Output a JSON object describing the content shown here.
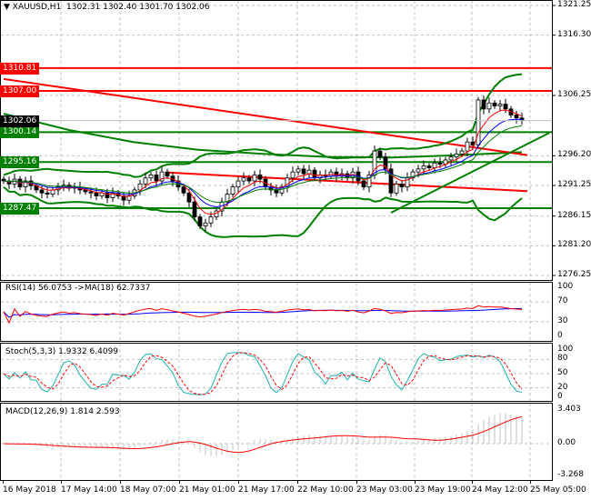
{
  "header": {
    "symbol_label": "XAUUSD,H1",
    "ohlc": "1302.31 1302.40 1301.70 1302.06"
  },
  "chart_data": {
    "type": "candlestick",
    "symbol": "XAUUSD",
    "timeframe": "H1",
    "price_ticks": [
      "1321.25",
      "1316.30",
      "1306.25",
      "1296.20",
      "1291.25",
      "1286.15",
      "1281.20",
      "1276.25"
    ],
    "ylim": [
      1276.25,
      1321.25
    ],
    "time_ticks": [
      "16 May 2018",
      "17 May 14:00",
      "18 May 07:00",
      "21 May 01:00",
      "21 May 17:00",
      "22 May 10:00",
      "23 May 03:00",
      "23 May 19:00",
      "24 May 12:00",
      "25 May 05:00"
    ],
    "closes": [
      1292,
      1291.5,
      1292.3,
      1291,
      1292,
      1291.2,
      1290.5,
      1290,
      1289.8,
      1290.5,
      1291,
      1291.3,
      1290.8,
      1291,
      1290.5,
      1290.2,
      1290,
      1289.5,
      1290,
      1289.2,
      1290,
      1289.5,
      1288.8,
      1289.5,
      1290.5,
      1291.5,
      1292.5,
      1293,
      1292,
      1293.5,
      1292.8,
      1292,
      1291,
      1290,
      1288.5,
      1286,
      1284.5,
      1285,
      1286,
      1287,
      1288.5,
      1289.8,
      1291,
      1292,
      1292.5,
      1292,
      1293,
      1292.3,
      1291,
      1290.5,
      1290,
      1291,
      1292.5,
      1293.5,
      1294,
      1293.2,
      1293.8,
      1292.5,
      1293,
      1292.8,
      1293.5,
      1292.8,
      1293.2,
      1292.5,
      1293.5,
      1292,
      1291,
      1293,
      1297,
      1296,
      1294,
      1290,
      1291.5,
      1291,
      1292.5,
      1293.5,
      1294,
      1294.5,
      1294.2,
      1295,
      1294.8,
      1295.5,
      1296,
      1296.5,
      1297,
      1298.5,
      1298,
      1305.5,
      1304,
      1305,
      1304.5,
      1304.8,
      1304,
      1303,
      1302.5,
      1302.06
    ],
    "slow_ma": [
      1303.2,
      1300.5,
      1298.5,
      1297.2,
      1296.5,
      1296,
      1295.9,
      1296.3,
      1296.8
    ],
    "levels": [
      {
        "price": 1310.81,
        "label": "1310.81",
        "color": "#ff0000"
      },
      {
        "price": 1307.0,
        "label": "1307.00",
        "color": "#ff0000"
      },
      {
        "price": 1300.14,
        "label": "1300.14",
        "color": "#008000"
      },
      {
        "price": 1295.16,
        "label": "1295.16",
        "color": "#008000"
      },
      {
        "price": 1287.47,
        "label": "1287.47",
        "color": "#008000"
      }
    ],
    "current_price": {
      "price": 1302.06,
      "label": "1302.06"
    },
    "trendlines": [
      {
        "from": [
          0,
          1309.0
        ],
        "to": [
          96,
          1296.3
        ],
        "color": "#ff0000"
      },
      {
        "from": [
          30,
          1293.4
        ],
        "to": [
          96,
          1290.3
        ],
        "color": "#ff0000"
      },
      {
        "from": [
          71,
          1286.7
        ],
        "to": [
          100,
          1300.0
        ],
        "color": "#008000"
      }
    ],
    "indicators": {
      "rsi": {
        "title": "RSI(14) 56.0753  ->MA(18) 62.7337",
        "ticks": [
          "100",
          "70",
          "30",
          "0"
        ],
        "color": "#ff0000",
        "ma_color": "#0000ff"
      },
      "stoch": {
        "title": "Stoch(5,3,3) 1.9332 6.4099",
        "ticks": [
          "100",
          "80",
          "50",
          "20",
          "0"
        ],
        "main_color": "#20b2aa",
        "signal_color": "#ff0000"
      },
      "macd": {
        "title": "MACD(12,26,9) 1.814 2.593",
        "ticks": [
          "3.403",
          "0.00",
          "-3.268"
        ],
        "hist_color": "#c0c0c0",
        "signal_color": "#ff0000"
      }
    }
  }
}
